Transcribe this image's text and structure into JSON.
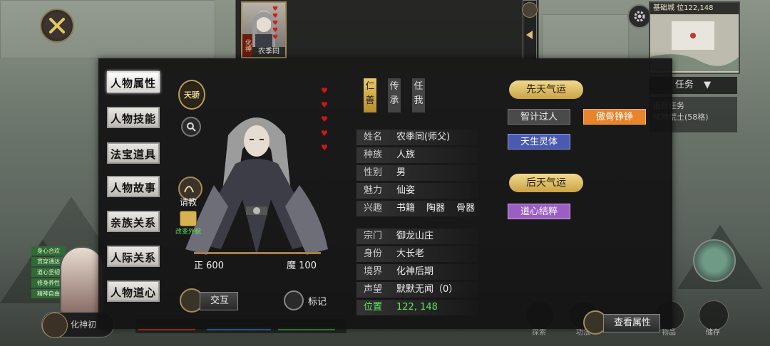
{
  "top": {
    "character_name": "农季同",
    "character_realm": "化神"
  },
  "minimap": {
    "header": "基础城 位122,148"
  },
  "tasks": {
    "title": "任务",
    "lines": [
      "追踪任务",
      "化险荒土(58格)"
    ]
  },
  "left_strip": {
    "tags": [
      "身心合欢",
      "贯穿通达",
      "道心坚韧",
      "修身养性",
      "精神自由"
    ],
    "button_label": "化神初"
  },
  "tabs": [
    "人物属性",
    "人物技能",
    "法宝道具",
    "人物故事",
    "亲族关系",
    "人际关系",
    "人物道心"
  ],
  "rank_emblem": "天骄",
  "portrait": {
    "consult_label": "请教",
    "change_look_label": "改变外貌",
    "righteous_label": "正",
    "righteous_value": "600",
    "demonic_label": "魔",
    "demonic_value": "100",
    "hearts": 5
  },
  "actions": {
    "interact": "交互",
    "mark": "标记",
    "view_attributes": "查看属性"
  },
  "traits": [
    "仁善",
    "传承",
    "任我"
  ],
  "info": {
    "name": {
      "label": "姓名",
      "value": "农季同(师父)"
    },
    "race": {
      "label": "种族",
      "value": "人族"
    },
    "gender": {
      "label": "性别",
      "value": "男"
    },
    "charm": {
      "label": "魅力",
      "value": "仙姿"
    },
    "hobby": {
      "label": "兴趣",
      "values": [
        "书籍",
        "陶器",
        "骨器"
      ]
    },
    "sect": {
      "label": "宗门",
      "value": "御龙山庄"
    },
    "identity": {
      "label": "身份",
      "value": "大长老"
    },
    "realm": {
      "label": "境界",
      "value": "化神后期"
    },
    "reputation": {
      "label": "声望",
      "value": "默默无闻（0）"
    },
    "position": {
      "label": "位置",
      "value": "122, 148"
    }
  },
  "innate_fortune": {
    "title": "先天气运",
    "tags": [
      {
        "label": "智计过人",
        "color": "#4a4a4a"
      },
      {
        "label": "傲骨铮铮",
        "color": "#e8852a"
      },
      {
        "label": "天生灵体",
        "color": "#4a5ab0"
      }
    ]
  },
  "acquired_fortune": {
    "title": "后天气运",
    "tags": [
      {
        "label": "道心结粹",
        "color": "#9b5ec2"
      }
    ]
  },
  "bottom_buttons": [
    "探索",
    "功法",
    "",
    "",
    "物品",
    "储存"
  ]
}
